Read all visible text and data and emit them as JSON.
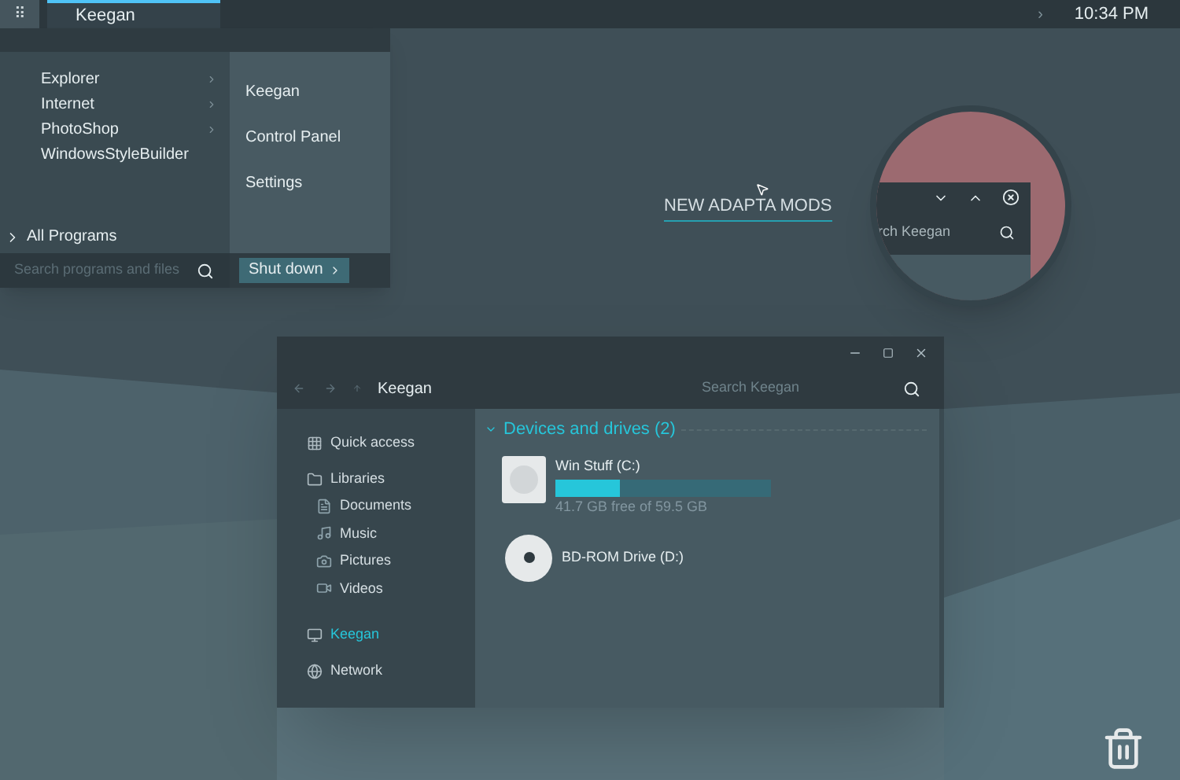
{
  "taskbar": {
    "start_glyph": "⠿",
    "items": [
      {
        "label": "Keegan",
        "selected": true
      }
    ],
    "tray_glyph": "›",
    "clock": "10:34 PM"
  },
  "start_menu": {
    "programs": [
      {
        "label": "Explorer",
        "has_submenu": true
      },
      {
        "label": "Internet",
        "has_submenu": true
      },
      {
        "label": "PhotoShop",
        "has_submenu": true
      },
      {
        "label": "WindowsStyleBuilder",
        "has_submenu": false
      }
    ],
    "all_programs": "All Programs",
    "places": [
      "Keegan",
      "Control Panel",
      "Settings"
    ],
    "search": {
      "placeholder": "Search programs and files"
    },
    "shutdown": "Shut down"
  },
  "desktop_link": "NEW ADAPTA MODS",
  "magnifier": {
    "search_text": "rch Keegan"
  },
  "explorer": {
    "path": "Keegan",
    "search": {
      "placeholder": "Search Keegan"
    },
    "sidebar": [
      {
        "label": "Quick access",
        "selected": false
      },
      {
        "label": "Libraries",
        "selected": false,
        "children": [
          {
            "label": "Documents",
            "selected": false
          },
          {
            "label": "Music",
            "selected": false
          },
          {
            "label": "Pictures",
            "selected": false
          },
          {
            "label": "Videos",
            "selected": false
          }
        ]
      },
      {
        "label": "Keegan",
        "selected": true
      },
      {
        "label": "Network",
        "selected": false
      }
    ],
    "group": {
      "title": "Devices and drives (2)",
      "expanded": true
    },
    "drives": [
      {
        "kind": "disk",
        "name": "Win Stuff (C:)",
        "level": 0.3,
        "space": "41.7 GB free of 59.5 GB"
      },
      {
        "kind": "optical",
        "name": "BD-ROM Drive (D:)"
      }
    ]
  }
}
